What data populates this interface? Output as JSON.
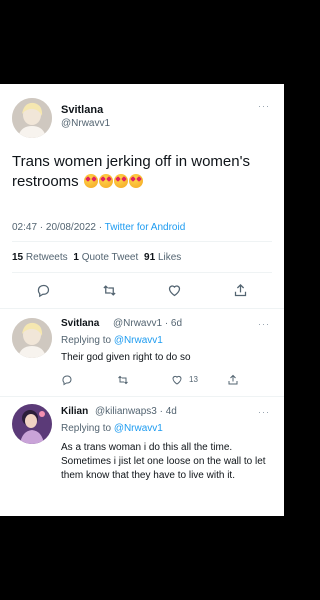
{
  "main_tweet": {
    "name": "Svitlana",
    "handle": "@Nrwavv1",
    "text": "Trans women jerking off in women's restrooms",
    "time_date": "02:47 · 20/08/2022 · ",
    "source": "Twitter for Android",
    "retweets_count": "15",
    "retweets_label": "Retweets",
    "quotes_count": "1",
    "quotes_label": "Quote Tweet",
    "likes_count": "91",
    "likes_label": "Likes"
  },
  "replies": [
    {
      "name": "Svitlana",
      "handle_time": "@Nrwavv1 · 6d",
      "replying_prefix": "Replying to ",
      "replying_to": "@Nrwavv1",
      "text": "Their god given right to do so",
      "likes_count": "13"
    },
    {
      "name": "Kilian",
      "handle_time": "@kilianwaps3 · 4d",
      "replying_prefix": "Replying to ",
      "replying_to": "@Nrwavv1",
      "text": "As a trans woman i do this all the time. Sometimes i jist let one loose on the wall to let them know that they have to live with it."
    }
  ],
  "icons": [
    "reply-icon",
    "retweet-icon",
    "like-icon",
    "share-icon",
    "more-icon",
    "heart-eyes-emoji"
  ],
  "colors": {
    "link": "#1d9bf0",
    "secondary_text": "#536471",
    "background_outer": "#000000"
  }
}
